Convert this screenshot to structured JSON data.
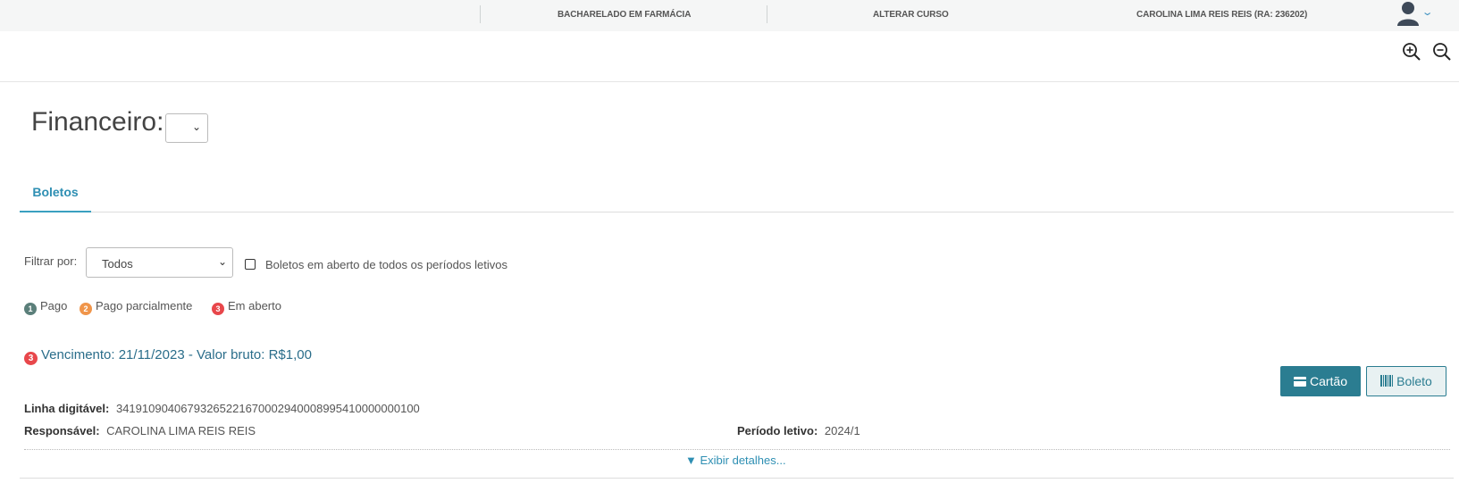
{
  "header": {
    "course": "BACHARELADO EM FARMÁCIA",
    "change_course": "ALTERAR CURSO",
    "user": "CAROLINA LIMA REIS REIS (RA: 236202)"
  },
  "page": {
    "title": "Financeiro:"
  },
  "tabs": [
    {
      "label": "Boletos"
    }
  ],
  "filter": {
    "label": "Filtrar por:",
    "selected": "Todos",
    "checkbox_label": "Boletos em aberto de todos os períodos letivos"
  },
  "legend": [
    {
      "num": "1",
      "label": "Pago",
      "color": "#5b7f7a"
    },
    {
      "num": "2",
      "label": "Pago parcialmente",
      "color": "#f0954a"
    },
    {
      "num": "3",
      "label": "Em aberto",
      "color": "#e8474b"
    }
  ],
  "boleto": {
    "status_num": "3",
    "title": "Vencimento: 21/11/2023 - Valor bruto: R$1,00",
    "btn_cartao": "Cartão",
    "btn_boleto": "Boleto",
    "linha_label": "Linha digitável:",
    "linha_value": "34191090406793265221670002940008995410000000100",
    "responsavel_label": "Responsável:",
    "responsavel_value": "CAROLINA LIMA REIS REIS",
    "periodo_label": "Período letivo:",
    "periodo_value": "2024/1",
    "details_link": "▼ Exibir detalhes..."
  },
  "colors": {
    "accent": "#2b7d91",
    "link": "#2e8fb3",
    "title_link": "#2a6d8a"
  }
}
